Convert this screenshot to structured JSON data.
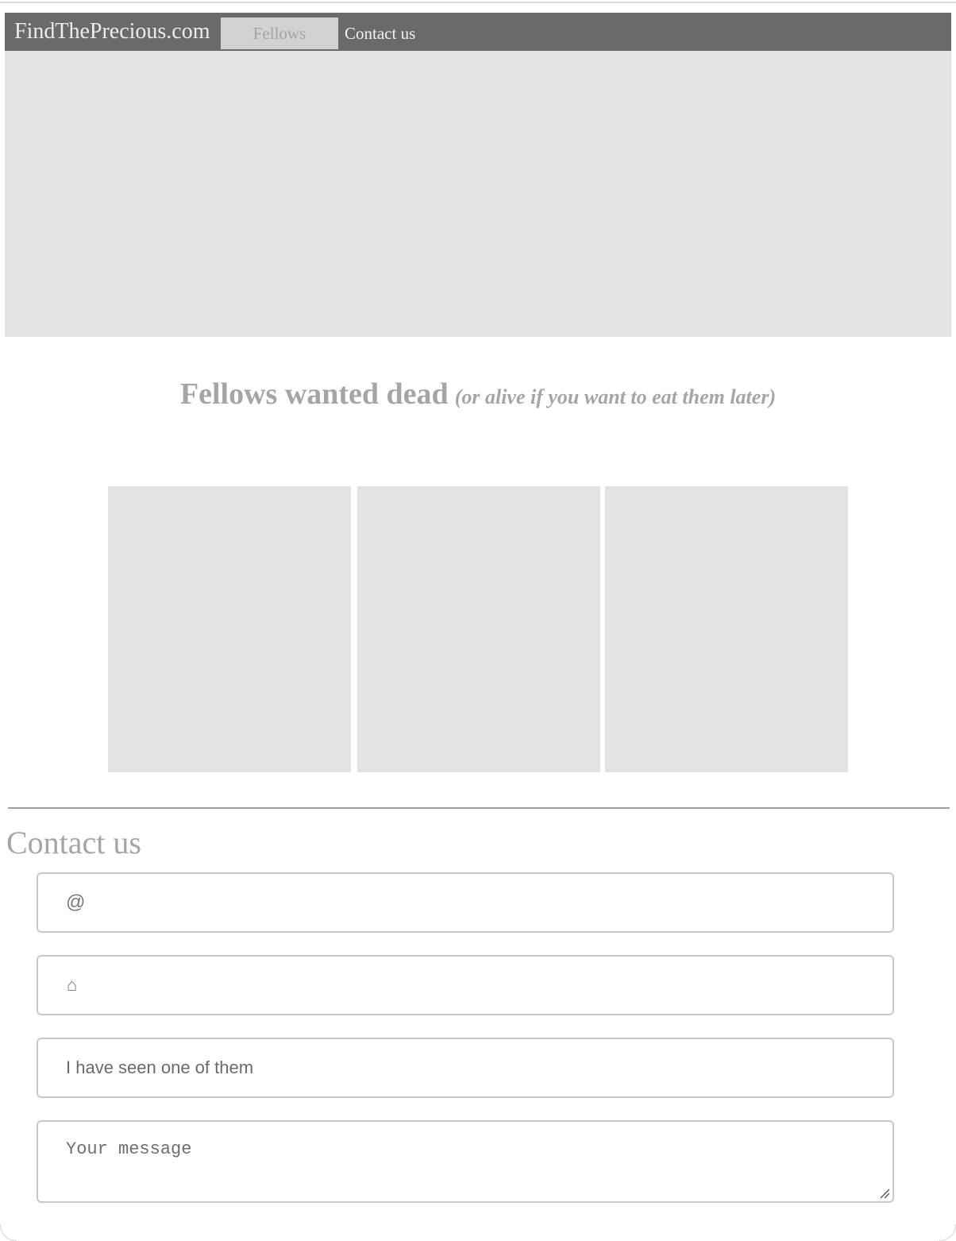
{
  "navbar": {
    "brand": "FindThePrecious.com",
    "items": [
      {
        "label": "Fellows",
        "active": true
      },
      {
        "label": "Contact us",
        "active": false
      }
    ]
  },
  "headline": {
    "main": "Fellows wanted dead",
    "sub": "(or alive if you want to eat them later)"
  },
  "contact": {
    "title": "Contact us",
    "email_icon": "@",
    "email_value": "",
    "home_icon": "⌂",
    "home_value": "",
    "subject_value": "I have seen one of them",
    "message_placeholder": "Your message"
  },
  "colors": {
    "navbar_bg": "#6a6a6a",
    "placeholder_block": "#e3e3e3",
    "muted_text": "#a5a5a5"
  }
}
